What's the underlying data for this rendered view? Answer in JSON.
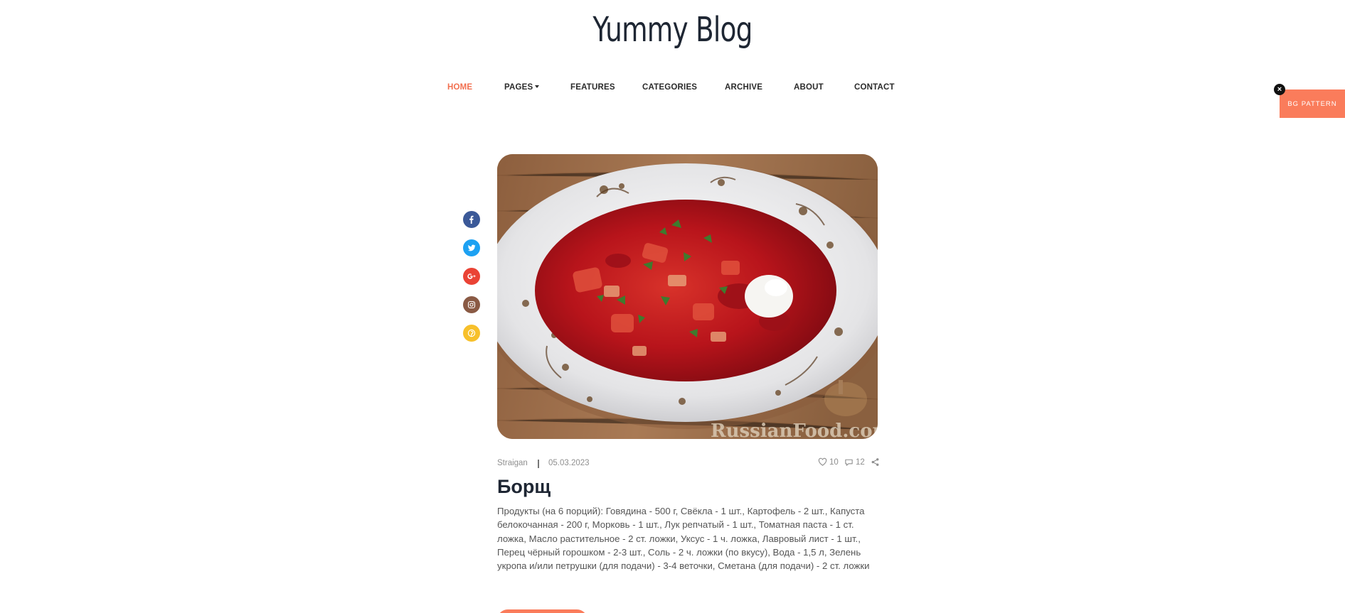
{
  "site": {
    "title": "Yummy Blog"
  },
  "nav": {
    "items": [
      {
        "label": "HOME",
        "active": true
      },
      {
        "label": "PAGES",
        "has_dropdown": true
      },
      {
        "label": "FEATURES"
      },
      {
        "label": "CATEGORIES"
      },
      {
        "label": "ARCHIVE"
      },
      {
        "label": "ABOUT"
      },
      {
        "label": "CONTACT"
      }
    ]
  },
  "bg_pattern": {
    "label": "BG PATTERN",
    "close_icon": "close-icon"
  },
  "social": [
    {
      "name": "facebook-icon",
      "color": "#3b5998"
    },
    {
      "name": "twitter-icon",
      "color": "#1da1f2"
    },
    {
      "name": "google-plus-icon",
      "color": "#ea4335"
    },
    {
      "name": "instagram-icon",
      "color": "#8a5a44"
    },
    {
      "name": "pinterest-icon",
      "color": "#f7c02b"
    }
  ],
  "post": {
    "image": {
      "watermark": "RussianFood.com"
    },
    "author": "Straigan",
    "date": "05.03.2023",
    "likes": "10",
    "comments": "12",
    "title": "Борщ",
    "body": "Продукты (на 6 порций): Говядина - 500 г, Свёкла - 1 шт., Картофель - 2 шт., Капуста белокочанная - 200 г, Морковь - 1 шт., Лук репчатый - 1 шт., Томатная паста - 1 ст. ложка, Масло растительное - 2 ст. ложки, Уксус - 1 ч. ложка, Лавровый лист - 1 шт., Перец чёрный горошком - 2-3 шт., Соль - 2 ч. ложки (по вкусу), Вода - 1,5 л, Зелень укропа и/или петрушки (для подачи) - 3-4 веточки, Сметана (для подачи) - 2 ст. ложки"
  },
  "colors": {
    "accent": "#fa7c5b",
    "active_nav": "#f26f4f",
    "heading": "#1e2633"
  }
}
